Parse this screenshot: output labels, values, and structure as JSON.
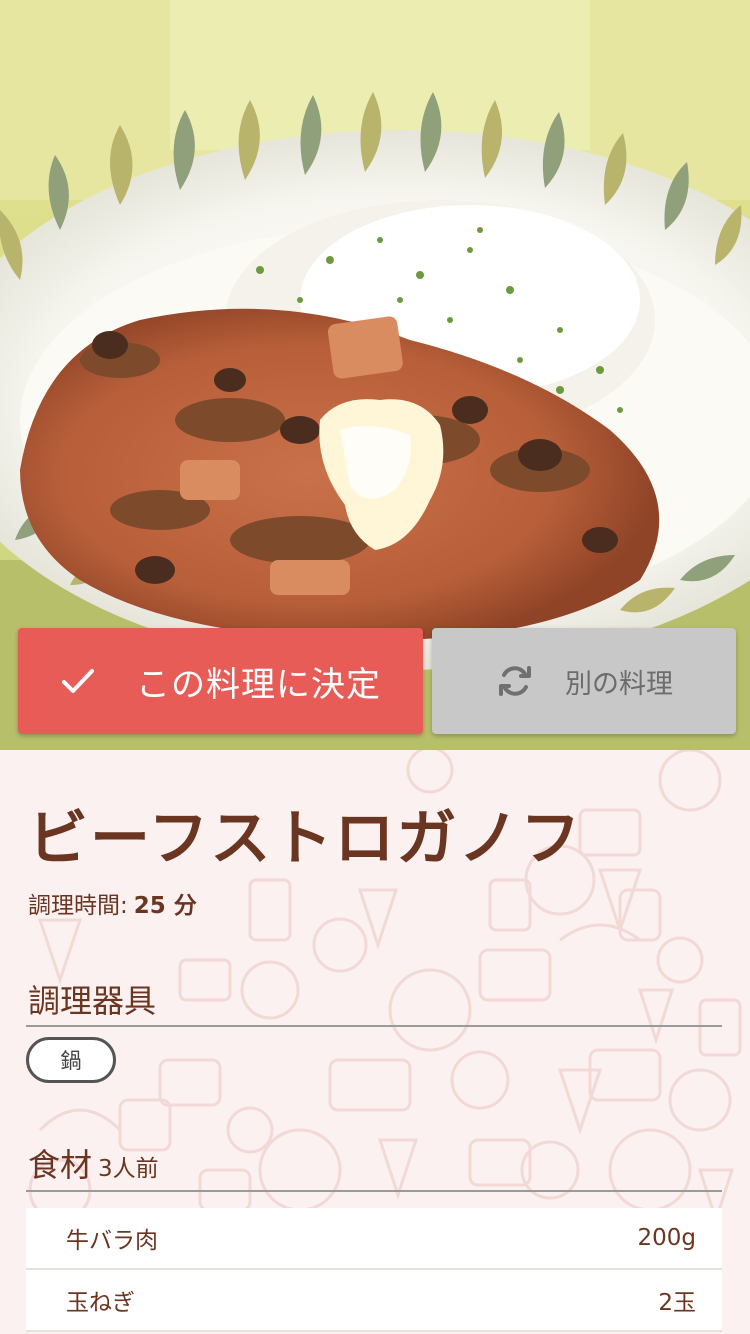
{
  "actions": {
    "decide": {
      "label": "この料理に決定",
      "icon": "check-icon"
    },
    "other": {
      "label": "別の料理",
      "icon": "refresh-icon"
    }
  },
  "recipe": {
    "title": "ビーフストロガノフ",
    "cook_time_label": "調理時間:",
    "cook_time_value": "25 分",
    "tools_heading": "調理器具",
    "tools": [
      "鍋"
    ],
    "ingredients_heading": "食材",
    "servings": "3人前",
    "ingredients": [
      {
        "name": "牛バラ肉",
        "amount": "200g"
      },
      {
        "name": "玉ねぎ",
        "amount": "2玉"
      }
    ]
  },
  "colors": {
    "primary": "#e85c58",
    "secondary": "#c8c8c8",
    "text_brown": "#6a3621",
    "background": "#fbf1f0"
  }
}
